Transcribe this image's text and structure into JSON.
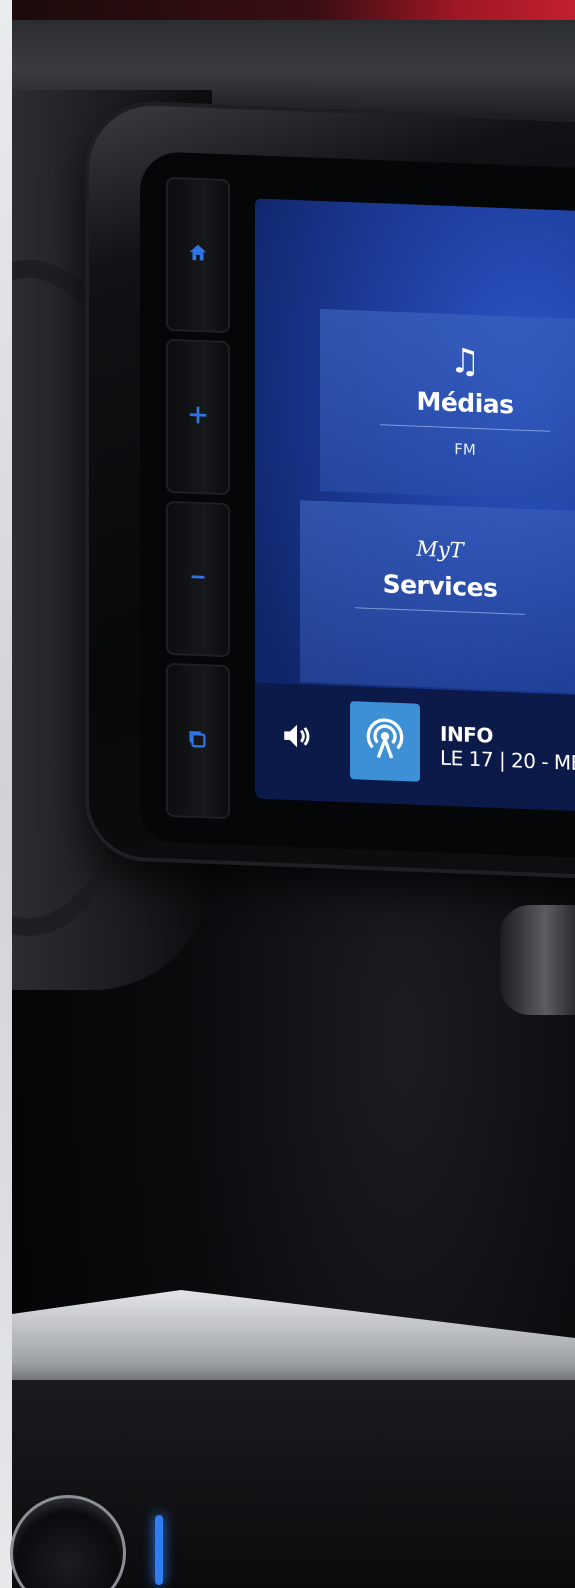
{
  "screen": {
    "tiles": [
      {
        "icon": "music-note-icon",
        "title": "Médias",
        "subtitle": "FM"
      },
      {
        "logo_text": "MyT",
        "title": "Services"
      }
    ],
    "bottom_bar": {
      "volume_icon": "speaker-volume-icon",
      "source_icon": "radio-broadcast-icon",
      "info_title": "INFO",
      "info_subtitle": "LE 17 | 20 - ME"
    }
  },
  "hardware_buttons": [
    {
      "icon": "home-icon"
    },
    {
      "icon": "plus-icon"
    },
    {
      "icon": "minus-icon"
    },
    {
      "icon": "copy-screens-icon"
    }
  ],
  "colors": {
    "button_glow": "#2f74e6",
    "display_blue": "#1d3d9c",
    "radio_tile": "#3d8fd6"
  }
}
